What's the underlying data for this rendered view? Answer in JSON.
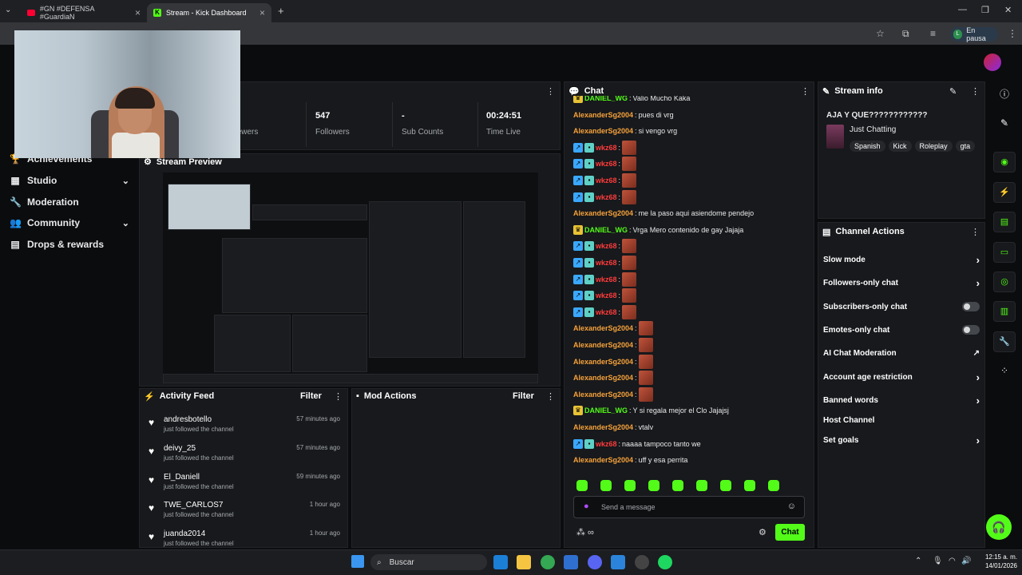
{
  "browser": {
    "tabs": [
      {
        "label": "#GN #DEFENSA #GuardiaN",
        "active": false
      },
      {
        "label": "Stream - Kick Dashboard",
        "active": true
      }
    ],
    "profile_label": "En pausa",
    "profile_initial": "L"
  },
  "sidebar": {
    "items": [
      {
        "label": "Achievements",
        "icon": "trophy-icon",
        "chevron": false
      },
      {
        "label": "Studio",
        "icon": "studio-icon",
        "chevron": true
      },
      {
        "label": "Moderation",
        "icon": "wrench-icon",
        "chevron": false
      },
      {
        "label": "Community",
        "icon": "people-icon",
        "chevron": true
      },
      {
        "label": "Drops & rewards",
        "icon": "gift-icon",
        "chevron": false
      }
    ]
  },
  "stats": {
    "viewers_label": "Viewers",
    "followers_value": "547",
    "followers_label": "Followers",
    "subs_value": "-",
    "subs_label": "Sub Counts",
    "time_value": "00:24:51",
    "time_label": "Time Live"
  },
  "preview": {
    "title": "Stream Preview"
  },
  "activity": {
    "title": "Activity Feed",
    "filter": "Filter",
    "items": [
      {
        "name": "andresbotello",
        "sub": "just followed the channel",
        "time": "57 minutes ago"
      },
      {
        "name": "deivy_25",
        "sub": "just followed the channel",
        "time": "57 minutes ago"
      },
      {
        "name": "El_Daniell",
        "sub": "just followed the channel",
        "time": "59 minutes ago"
      },
      {
        "name": "TWE_CARLOS7",
        "sub": "just followed the channel",
        "time": "1 hour ago"
      },
      {
        "name": "juanda2014",
        "sub": "just followed the channel",
        "time": "1 hour ago"
      }
    ]
  },
  "mod_actions": {
    "title": "Mod Actions",
    "filter": "Filter"
  },
  "chat": {
    "title": "Chat",
    "messages": [
      {
        "user": "DANIEL_WG",
        "color": "green",
        "badge": "crown",
        "text": "Valio Mucho Kaka",
        "emote": false
      },
      {
        "user": "AlexanderSg2004",
        "color": "orange",
        "badge": "",
        "text": "pues di vrg",
        "emote": false
      },
      {
        "user": "AlexanderSg2004",
        "color": "orange",
        "badge": "",
        "text": "si vengo vrg",
        "emote": false
      },
      {
        "user": "wkz68",
        "color": "red",
        "badge": "bg",
        "text": "",
        "emote": true
      },
      {
        "user": "wkz68",
        "color": "red",
        "badge": "bg",
        "text": "",
        "emote": true
      },
      {
        "user": "wkz68",
        "color": "red",
        "badge": "bg",
        "text": "",
        "emote": true
      },
      {
        "user": "wkz68",
        "color": "red",
        "badge": "bg",
        "text": "",
        "emote": true
      },
      {
        "user": "AlexanderSg2004",
        "color": "orange",
        "badge": "",
        "text": "me la paso aqui asiendome pendejo",
        "emote": false
      },
      {
        "user": "DANIEL_WG",
        "color": "green",
        "badge": "crown",
        "text": "Vrga Mero contenido de gay Jajaja",
        "emote": false
      },
      {
        "user": "wkz68",
        "color": "red",
        "badge": "bg",
        "text": "",
        "emote": true
      },
      {
        "user": "wkz68",
        "color": "red",
        "badge": "bg",
        "text": "",
        "emote": true
      },
      {
        "user": "wkz68",
        "color": "red",
        "badge": "bg",
        "text": "",
        "emote": true
      },
      {
        "user": "wkz68",
        "color": "red",
        "badge": "bg",
        "text": "",
        "emote": true
      },
      {
        "user": "wkz68",
        "color": "red",
        "badge": "bg",
        "text": "",
        "emote": true
      },
      {
        "user": "AlexanderSg2004",
        "color": "orange",
        "badge": "",
        "text": "",
        "emote": true
      },
      {
        "user": "AlexanderSg2004",
        "color": "orange",
        "badge": "",
        "text": "",
        "emote": true
      },
      {
        "user": "AlexanderSg2004",
        "color": "orange",
        "badge": "",
        "text": "",
        "emote": true
      },
      {
        "user": "AlexanderSg2004",
        "color": "orange",
        "badge": "",
        "text": "",
        "emote": true
      },
      {
        "user": "AlexanderSg2004",
        "color": "orange",
        "badge": "",
        "text": "",
        "emote": true
      },
      {
        "user": "DANIEL_WG",
        "color": "green",
        "badge": "crown",
        "text": "Y si regala mejor el Clo Jajajsj",
        "emote": false
      },
      {
        "user": "AlexanderSg2004",
        "color": "orange",
        "badge": "",
        "text": "vtalv",
        "emote": false
      },
      {
        "user": "wkz68",
        "color": "red",
        "badge": "bg",
        "text": "naaaa tampoco tanto we",
        "emote": false
      },
      {
        "user": "AlexanderSg2004",
        "color": "orange",
        "badge": "",
        "text": "uff y esa perrita",
        "emote": false
      }
    ],
    "placeholder": "Send a message",
    "send_label": "Chat"
  },
  "stream_info": {
    "title": "Stream info",
    "stream_title": "AJA Y QUE????????????",
    "category": "Just Chatting",
    "tags": [
      "Spanish",
      "Kick",
      "Roleplay",
      "gta"
    ]
  },
  "channel_actions": {
    "title": "Channel Actions",
    "items": [
      {
        "label": "Slow mode",
        "control": "chevron"
      },
      {
        "label": "Followers-only chat",
        "control": "chevron"
      },
      {
        "label": "Subscribers-only chat",
        "control": "toggle"
      },
      {
        "label": "Emotes-only chat",
        "control": "toggle"
      },
      {
        "label": "AI Chat Moderation",
        "control": "external"
      },
      {
        "label": "Account age restriction",
        "control": "chevron"
      },
      {
        "label": "Banned words",
        "control": "chevron"
      },
      {
        "label": "Host Channel",
        "control": "none"
      },
      {
        "label": "Set goals",
        "control": "chevron"
      }
    ]
  },
  "taskbar": {
    "search_label": "Buscar",
    "time": "12:15 a. m.",
    "date": "14/01/2026"
  },
  "colors": {
    "accent": "#53fc18",
    "panel": "#17191c",
    "orange_user": "#f7a23b",
    "red_user": "#ff3b3b"
  }
}
